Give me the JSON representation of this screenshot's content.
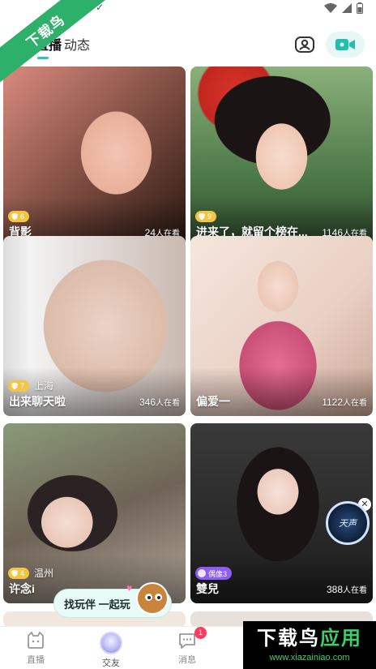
{
  "status_bar": {
    "icons": [
      "wifi-icon",
      "signal-icon",
      "battery-icon"
    ]
  },
  "top_nav": {
    "tabs": [
      {
        "label": "直播",
        "active": true
      },
      {
        "label": "动态",
        "active": false
      }
    ],
    "accent_color": "#29c4c4"
  },
  "cards": [
    {
      "title": "背影",
      "level": "6",
      "viewers": "24",
      "viewers_unit": "人在看"
    },
    {
      "title": "进来了，就留个榜在...",
      "level": "9",
      "viewers": "1146",
      "viewers_unit": "人在看"
    },
    {
      "title": "出来聊天啦",
      "level": "7",
      "city": "上海",
      "viewers": "346",
      "viewers_unit": "人在看"
    },
    {
      "title": "偏爱一",
      "viewers": "1122",
      "viewers_unit": "人在看"
    },
    {
      "title": "许念i",
      "level": "4",
      "city": "温州",
      "viewers": "",
      "viewers_unit": ""
    },
    {
      "title": "雙兒",
      "badge": "偶像3",
      "viewers": "388",
      "viewers_unit": "人在看"
    }
  ],
  "music_disc": {
    "label": "天声"
  },
  "companion_banner": {
    "text": "找玩伴 一起玩"
  },
  "bottom_nav": {
    "items": [
      {
        "label": "直播",
        "icon": "live-icon"
      },
      {
        "label": "交友",
        "icon": "avatar"
      },
      {
        "label": "消息",
        "icon": "message-icon",
        "badge": "1"
      }
    ]
  },
  "watermarks": {
    "top": "下载鸟",
    "bottom_title_a": "下载鸟",
    "bottom_title_b": "应用",
    "bottom_url": "www.xiazainiao.com"
  }
}
